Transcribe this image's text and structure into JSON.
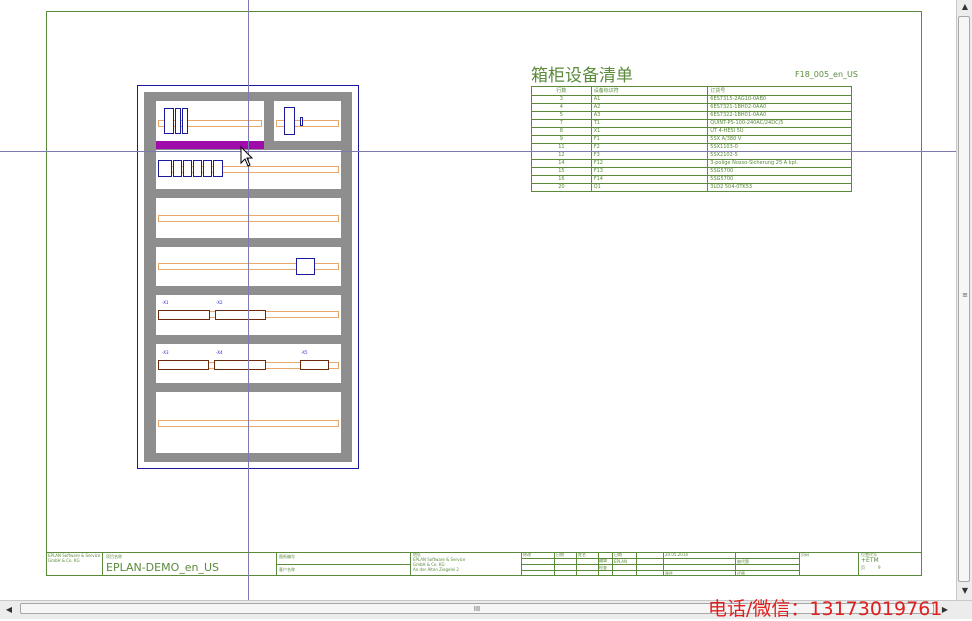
{
  "bom": {
    "title": "箱柜设备清单",
    "ref": "F18_005_en_US",
    "headers": [
      "行数",
      "设备标识符",
      "订货号"
    ],
    "rows": [
      [
        "3",
        "A1",
        "6ES7315-2AG10-0AB0"
      ],
      [
        "4",
        "A2",
        "6ES7321-1BH02-0AA0"
      ],
      [
        "5",
        "A3",
        "6ES7322-1BH01-0AA0"
      ],
      [
        "7",
        "T1",
        "QUINT-PS-100-240AC/24DC/5"
      ],
      [
        "8",
        "X1",
        "UT 4-HESI 5U"
      ],
      [
        "9",
        "F1",
        "5SX A/380 V"
      ],
      [
        "11",
        "F2",
        "5SX1103-0"
      ],
      [
        "12",
        "F3",
        "5SX2102-5"
      ],
      [
        "14",
        "F12",
        "3-polige Nosso-Sicherung 25 A kpl."
      ],
      [
        "15",
        "F13",
        "5SG5700"
      ],
      [
        "16",
        "F14",
        "5SG5700"
      ],
      [
        "20",
        "Q1",
        "3LD2 504-0TK53"
      ]
    ]
  },
  "titleblock": {
    "company_left": [
      "EPLAN Software & Service",
      "GmbH & Co. KG"
    ],
    "project_label": "项目名称",
    "project_name": "EPLAN-DEMO_en_US",
    "drawing_no_label": "图纸编号",
    "customer_label": "客户名称",
    "company_right": [
      "地址",
      "EPLAN Software & Service",
      "GmbH & Co. KG",
      "An der Alten Ziegelei 2",
      "D-40789 Monheim am Rhein, Germany"
    ],
    "fields": [
      "修改",
      "日期",
      "姓名",
      "日期",
      "20.05.2014",
      "编辑",
      "EPLAN",
      "检查",
      "原件",
      "代替",
      "被代替",
      "页码"
    ],
    "sheet_label": "位置代号",
    "sheet_value": "+ETM",
    "page_label": "页",
    "page_value": "9"
  },
  "cabinet_tags": {
    "row5": [
      "-X1",
      "-X2"
    ],
    "row6": [
      "-X3",
      "-X4",
      "-X5"
    ]
  },
  "scrollbar": {
    "grip": "III",
    "left_arrow": "◀",
    "right_arrow": "▶",
    "up_arrow": "▲",
    "down_arrow": "▼"
  },
  "watermark": "电话/微信：13173019761",
  "colors": {
    "frame": "#5a8a3a",
    "cabinet_border": "#1a1a9a",
    "panel_gray": "#8e8e8e",
    "rail": "#e7a86a",
    "highlight": "#a00caa",
    "watermark": "#e02020"
  }
}
